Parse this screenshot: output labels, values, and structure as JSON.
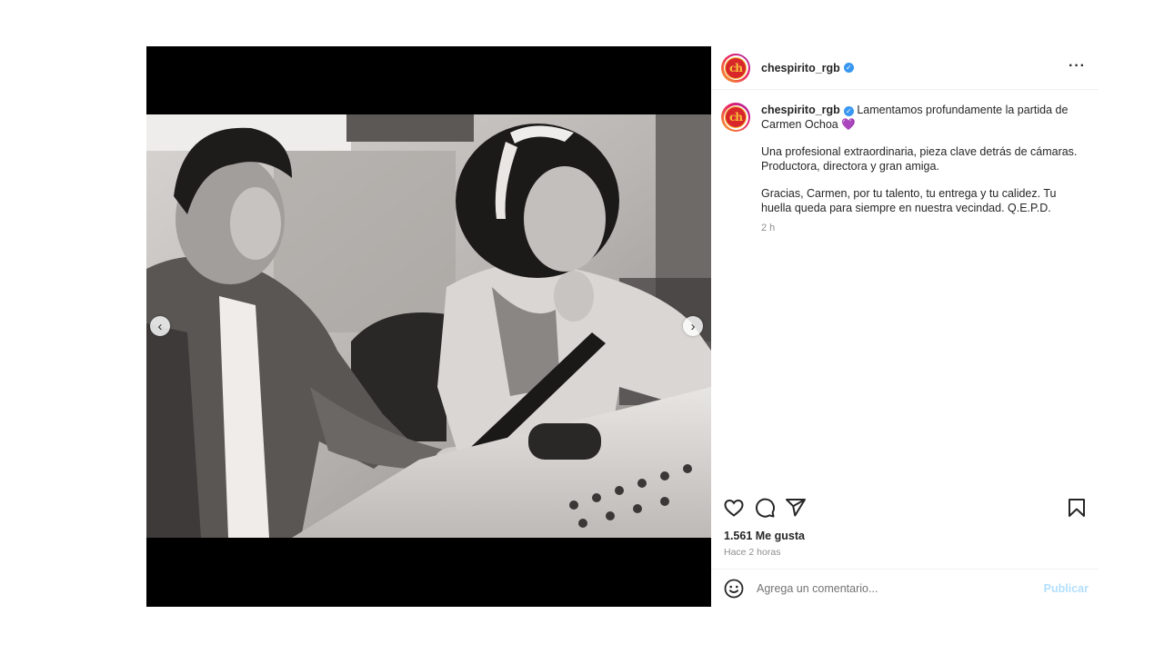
{
  "post": {
    "username": "chespirito_rgb",
    "avatar_logo_text": "ch",
    "more_icon": "more-horizontal-icon",
    "caption": {
      "username": "chespirito_rgb",
      "line1": "Lamentamos profundamente la partida de Carmen Ochoa",
      "heart": "💜",
      "paragraph2": "Una profesional extraordinaria, pieza clave detrás de cámaras. Productora, directora y gran amiga.",
      "paragraph3": "Gracias, Carmen, por tu talento, tu entrega y tu calidez. Tu huella queda para siempre en nuestra vecindad. Q.E.P.D.",
      "time": "2 h"
    },
    "media": {
      "description_icon": "photo",
      "prev_label": "‹",
      "next_label": "›"
    },
    "likes": "1.561 Me gusta",
    "ago": "Hace 2 horas",
    "comment": {
      "placeholder": "Agrega un comentario...",
      "value": "",
      "publish_label": "Publicar"
    },
    "colors": {
      "verified": "#3897f0",
      "publish_disabled": "#b2dffc",
      "logo_red": "#d8262b",
      "logo_yellow": "#f6c23a"
    }
  }
}
